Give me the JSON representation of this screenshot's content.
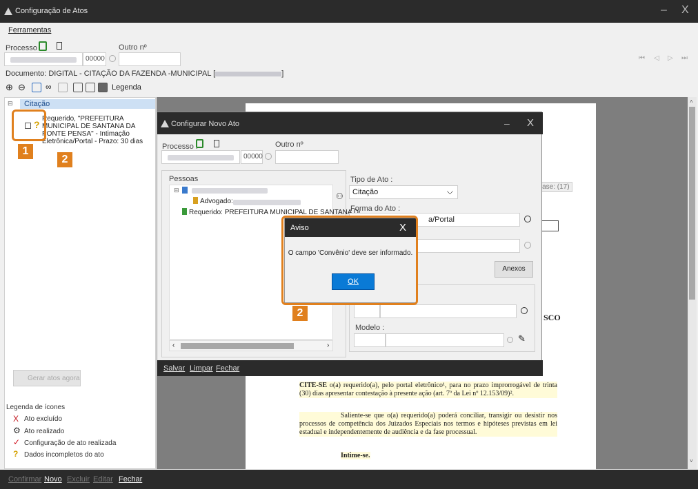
{
  "window": {
    "title": "Configuração de Atos",
    "minimize": "–",
    "close": "X"
  },
  "menu": {
    "ferramentas": "Ferramentas"
  },
  "processo": {
    "label": "Processo",
    "number_suffix": "00000",
    "outro_label": "Outro nº"
  },
  "document": {
    "text": "Documento:  DIGITAL - CITAÇÃO DA FAZENDA -MUNICIPAL ["
  },
  "toolbar": {
    "legenda": "Legenda"
  },
  "tree": {
    "root": "Citação",
    "item_text": "Requerido, \"PREFEITURA MUNICIPAL DE SANTANA DA PONTE PENSA\" - Intimação Eletrônica/Portal - Prazo: 30 dias"
  },
  "left": {
    "gerar_button": "Gerar atos agora",
    "legend_title": "Legenda de ícones",
    "legend": [
      {
        "icon": "X",
        "text": "Ato excluído",
        "color": "#c0141c"
      },
      {
        "icon": "⚙",
        "text": "Ato realizado",
        "color": "#333333"
      },
      {
        "icon": "✓",
        "text": "Configuração de ato realizada",
        "color": "#d0101c"
      },
      {
        "icon": "?",
        "text": "Dados incompletos do ato",
        "color": "#d4a000"
      }
    ]
  },
  "badges": {
    "one": "1",
    "two": "2",
    "three": "2"
  },
  "bottom": {
    "confirmar": "Confirmar",
    "novo": "Novo",
    "excluir": "Excluir",
    "editar": "Editar",
    "fechar": "Fechar"
  },
  "document_view": {
    "fase": "Fase: (17)",
    "sco": "SCO",
    "p1_bold": "CITE-SE",
    "p1": " o(a) requerido(a), pelo portal eletrônico¹,  para no prazo improrrogável de trinta (30) dias apresentar contestação à presente ação (art. 7º da Lei nº 12.153/09)².",
    "p2": "Saliente-se que o(a) requerido(a) poderá conciliar, transigir ou desistir nos processos de competência dos Juizados Especiais nos termos e hipóteses previstas em lei estadual e independentemente de audiência e da fase processual.",
    "p3": "Intime-se."
  },
  "dialog": {
    "title": "Configurar Novo Ato",
    "processo_label": "Processo :",
    "number_suffix": "00000",
    "outro_label": "Outro nº",
    "pessoas_label": "Pessoas",
    "advogado": "Advogado:",
    "requerido": "Requerido: PREFEITURA MUNICIPAL DE SANTANA D/",
    "tipo_label": "Tipo de Ato :",
    "tipo_value": "Citação",
    "forma_label": "Forma do Ato :",
    "forma_value": "a/Portal",
    "anexos": "Anexos",
    "modelo_label": "Modelo :",
    "salvar": "Salvar",
    "limpar": "Limpar",
    "fechar": "Fechar",
    "close": "X",
    "minimize": "–"
  },
  "aviso": {
    "title": "Aviso",
    "message": "O campo 'Convênio' deve ser informado.",
    "ok": "OK",
    "close": "X"
  }
}
